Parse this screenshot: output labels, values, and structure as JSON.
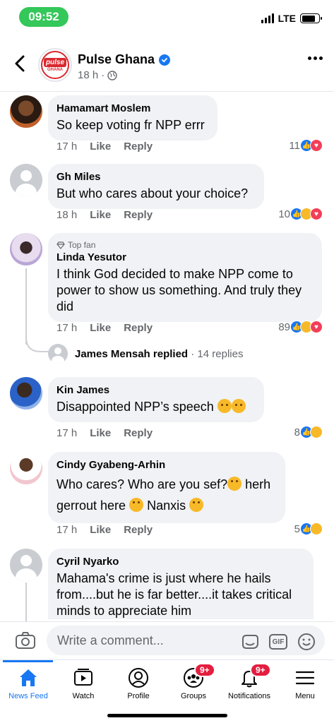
{
  "status": {
    "time": "09:52",
    "network": "LTE"
  },
  "header": {
    "page_name": "Pulse Ghana",
    "time_ago": "18 h",
    "logo_top": "pulse",
    "logo_bottom": "GHANA"
  },
  "comments": [
    {
      "name": "Hamamart Moslem",
      "text": "So keep voting fr NPP errr",
      "time": "17 h",
      "like": "Like",
      "reply": "Reply",
      "reaction_count": "11",
      "reactions": [
        "like",
        "love"
      ]
    },
    {
      "name": "Gh Miles",
      "text": "But who cares about your choice?",
      "time": "18 h",
      "like": "Like",
      "reply": "Reply",
      "reaction_count": "10",
      "reactions": [
        "like",
        "haha",
        "love"
      ]
    },
    {
      "badge": "Top fan",
      "name": "Linda Yesutor",
      "text": "I think God decided to make NPP come to power to show us something. And truly they did",
      "time": "17 h",
      "like": "Like",
      "reply": "Reply",
      "reaction_count": "89",
      "reactions": [
        "like",
        "haha",
        "love"
      ]
    },
    {
      "name": "Kin James",
      "text": "Disappointed NPP’s speech",
      "time": "17 h",
      "like": "Like",
      "reply": "Reply",
      "reaction_count": "8",
      "reactions": [
        "like",
        "sad"
      ]
    },
    {
      "name": "Cindy Gyabeng-Arhin",
      "text_1": "Who cares? Who are you sef?",
      "text_2": "herh",
      "text_3": "gerrout here",
      "text_4": "Nanxis",
      "time": "17 h",
      "like": "Like",
      "reply": "Reply",
      "reaction_count": "5",
      "reactions": [
        "like",
        "haha"
      ]
    },
    {
      "name": "Cyril Nyarko",
      "text": "Mahama's crime is just where he hails from....but he is far better....it takes critical minds to appreciate him"
    }
  ],
  "replies": {
    "name": "James Mensah",
    "action": "replied",
    "count": "· 14 replies"
  },
  "composer": {
    "placeholder": "Write a comment...",
    "gif": "GIF"
  },
  "tabs": [
    {
      "label": "News Feed",
      "active": true
    },
    {
      "label": "Watch"
    },
    {
      "label": "Profile"
    },
    {
      "label": "Groups",
      "badge": "9+"
    },
    {
      "label": "Notifications",
      "badge": "9+"
    },
    {
      "label": "Menu"
    }
  ],
  "colors": {
    "accent": "#1877f2",
    "badge": "#e41e3f",
    "time_pill": "#34c759"
  }
}
